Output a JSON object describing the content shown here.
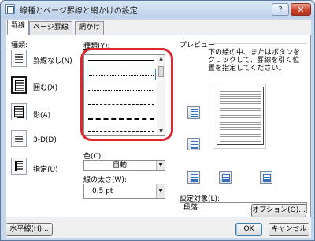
{
  "window": {
    "title": "線種とページ罫線と網かけの設定",
    "help": "?",
    "close": "✕"
  },
  "tabs": [
    {
      "label": "罫線",
      "active": true
    },
    {
      "label": "ページ罫線",
      "active": false
    },
    {
      "label": "網かけ",
      "active": false
    }
  ],
  "setting": {
    "label": "種類:",
    "items": [
      {
        "label": "罫線なし(N)",
        "icon": "no-border-icon",
        "selected": false
      },
      {
        "label": "囲む(X)",
        "icon": "box-border-icon",
        "selected": true
      },
      {
        "label": "影(A)",
        "icon": "shadow-border-icon",
        "selected": false
      },
      {
        "label": "3-D(D)",
        "icon": "3d-border-icon",
        "selected": false
      },
      {
        "label": "指定(U)",
        "icon": "custom-border-icon",
        "selected": false
      }
    ]
  },
  "style": {
    "label": "種類(Y):"
  },
  "color": {
    "label": "色(C):",
    "value": "自動"
  },
  "width": {
    "label": "線の太さ(W):",
    "value": "0.5 pt"
  },
  "preview": {
    "label": "プレビュー",
    "instructions_line1": "下の絵の中、またはボタンを",
    "instructions_line2": "クリックして、罫線を引く位",
    "instructions_line3": "置を指定してください。"
  },
  "apply_to": {
    "label": "設定対象(L):",
    "value": "段落"
  },
  "buttons": {
    "options": "オプション(O)...",
    "horizontal_line": "水平線(H)...",
    "ok": "OK",
    "cancel": "キャンセル"
  },
  "colors": {
    "highlight": "#e0252e",
    "accent": "#3a6fc0"
  }
}
